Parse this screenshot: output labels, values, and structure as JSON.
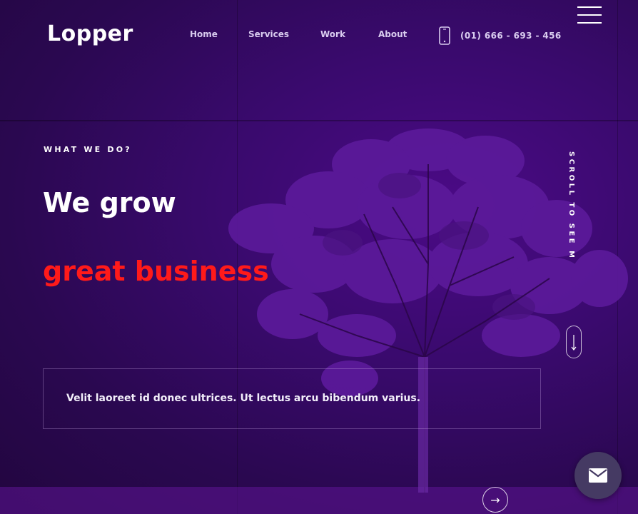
{
  "brand": {
    "logo": "Lopper"
  },
  "nav": {
    "items": [
      {
        "label": "Home"
      },
      {
        "label": "Services"
      },
      {
        "label": "Work"
      },
      {
        "label": "About"
      }
    ],
    "phone": "(01) 666 - 693 - 456"
  },
  "hero": {
    "eyebrow": "WHAT WE DO?",
    "heading_line1": "We grow",
    "heading_line2": "great business",
    "quote": "Velit laoreet id donec ultrices. Ut lectus arcu bibendum varius.",
    "scroll_hint": "SCROLL TO SEE MORE"
  },
  "icons": {
    "menu": "hamburger-menu-icon",
    "phone": "smartphone-icon",
    "scroll": "arrow-down-icon",
    "next": "arrow-right-icon",
    "mail": "envelope-icon"
  },
  "colors": {
    "background": "#3a0a6e",
    "accent": "#ff1a1a",
    "tree": "#5e1a9e",
    "mail_button": "#453a63"
  }
}
